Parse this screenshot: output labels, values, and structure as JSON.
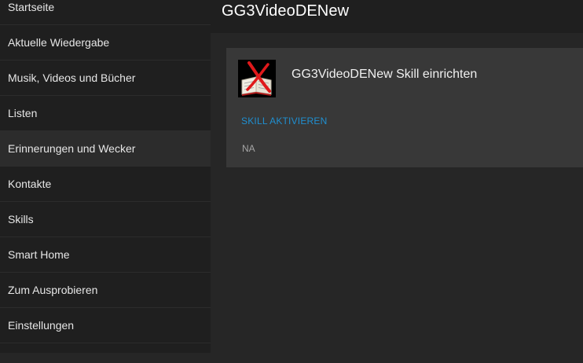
{
  "sidebar": {
    "items": [
      {
        "label": "Startseite"
      },
      {
        "label": "Aktuelle Wiedergabe"
      },
      {
        "label": "Musik, Videos und Bücher"
      },
      {
        "label": "Listen"
      },
      {
        "label": "Erinnerungen und Wecker"
      },
      {
        "label": "Kontakte"
      },
      {
        "label": "Skills"
      },
      {
        "label": "Smart Home"
      },
      {
        "label": "Zum Ausprobieren"
      },
      {
        "label": "Einstellungen"
      }
    ],
    "active_index": 4
  },
  "header": {
    "title": "GG3VideoDENew"
  },
  "skill_card": {
    "icon": "skill-book-icon",
    "title": "GG3VideoDENew Skill einrichten",
    "activate_label": "SKILL AKTIVIEREN",
    "status": "NA"
  },
  "colors": {
    "sidebar_bg": "#1f1f1f",
    "main_bg": "#262626",
    "card_bg": "#383838",
    "link": "#1f8fd1"
  }
}
